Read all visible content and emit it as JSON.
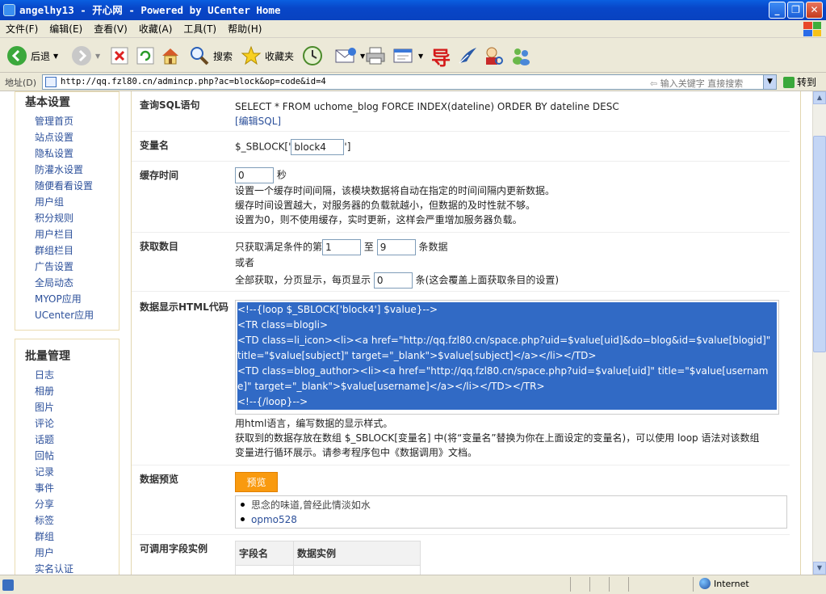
{
  "window": {
    "title": "angelhy13 - 开心网 - Powered by UCenter Home",
    "controls": [
      "_",
      "❐",
      "✕"
    ]
  },
  "menu": [
    "文件(F)",
    "编辑(E)",
    "查看(V)",
    "收藏(A)",
    "工具(T)",
    "帮助(H)"
  ],
  "toolbar": {
    "back": "后退",
    "search": "搜索",
    "favorites": "收藏夹"
  },
  "address": {
    "label": "地址(D)",
    "url": "http://qq.fzl80.cn/admincp.php?ac=block&op=code&id=4",
    "hint": "输入关键字 直接搜索",
    "go": "转到"
  },
  "sidebar": {
    "sections": [
      {
        "title": "基本设置",
        "items": [
          "管理首页",
          "站点设置",
          "隐私设置",
          "防灌水设置",
          "随便看看设置",
          "用户组",
          "积分规则",
          "用户栏目",
          "群组栏目",
          "广告设置",
          "全局动态",
          "MYOP应用",
          "UCenter应用"
        ]
      },
      {
        "title": "批量管理",
        "items": [
          "日志",
          "相册",
          "图片",
          "评论",
          "话题",
          "回帖",
          "记录",
          "事件",
          "分享",
          "标签",
          "群组",
          "用户",
          "实名认证"
        ]
      }
    ]
  },
  "form": {
    "sql": {
      "label": "查询SQL语句",
      "value": "SELECT * FROM uchome_blog FORCE INDEX(dateline) ORDER BY dateline DESC",
      "edit": "[编辑SQL]"
    },
    "var": {
      "label": "变量名",
      "prefix": "$_SBLOCK['",
      "value": "block4",
      "suffix": "']"
    },
    "cache": {
      "label": "缓存时间",
      "value": "0",
      "unit": "秒",
      "help1": "设置一个缓存时间间隔，该模块数据将自动在指定的时间间隔内更新数据。",
      "help2": "缓存时间设置越大，对服务器的负载就越小，但数据的及时性就不够。",
      "help3": "设置为0，则不使用缓存，实时更新，这样会严重增加服务器负载。"
    },
    "fetch": {
      "label": "获取数目",
      "line1_pre": "只获取满足条件的第",
      "start": "1",
      "to": "至",
      "end": "9",
      "line1_post": "条数据",
      "or": "或者",
      "line3_pre": "全部获取，分页显示，每页显示",
      "per_page": "0",
      "line3_post": "条(这会覆盖上面获取条目的设置)"
    },
    "html": {
      "label": "数据显示HTML代码",
      "lines": [
        "<!--{loop $_SBLOCK['block4'] $value}-->",
        "<TR class=blogli>",
        "<TD class=li_icon><li><a  href=\"http://qq.fzl80.cn/space.php?uid=$value[uid]&do=blog&id=$value[blogid]\" title=\"$value[subject]\" target=\"_blank\">$value[subject]</a></li></TD>",
        "<TD class=blog_author><li><a href=\"http://qq.fzl80.cn/space.php?uid=$value[uid]\" title=\"$value[username]\" target=\"_blank\">$value[username]</a></li></TD></TR>",
        "<!--{/loop}-->"
      ],
      "help1": "用html语言，编写数据的显示样式。",
      "help2": "获取到的数据存放在数组 $_SBLOCK[变量名] 中(将“变量名”替换为你在上面设定的变量名)，可以使用 loop 语法对该数组",
      "help3": "变量进行循环展示。请参考程序包中《数据调用》文档。"
    },
    "preview": {
      "label": "数据预览",
      "button": "预览",
      "items": [
        "思念的味道,曾经此情淡如水",
        "opmo528"
      ]
    },
    "fields": {
      "label": "可调用字段实例",
      "headers": [
        "字段名",
        "数据实例"
      ]
    }
  },
  "status": {
    "zone": "Internet"
  },
  "colors": {
    "titlebar": "#0846c8",
    "selection": "#316ac5",
    "preview_button": "#f99a0f",
    "link": "#2b4f9a"
  }
}
